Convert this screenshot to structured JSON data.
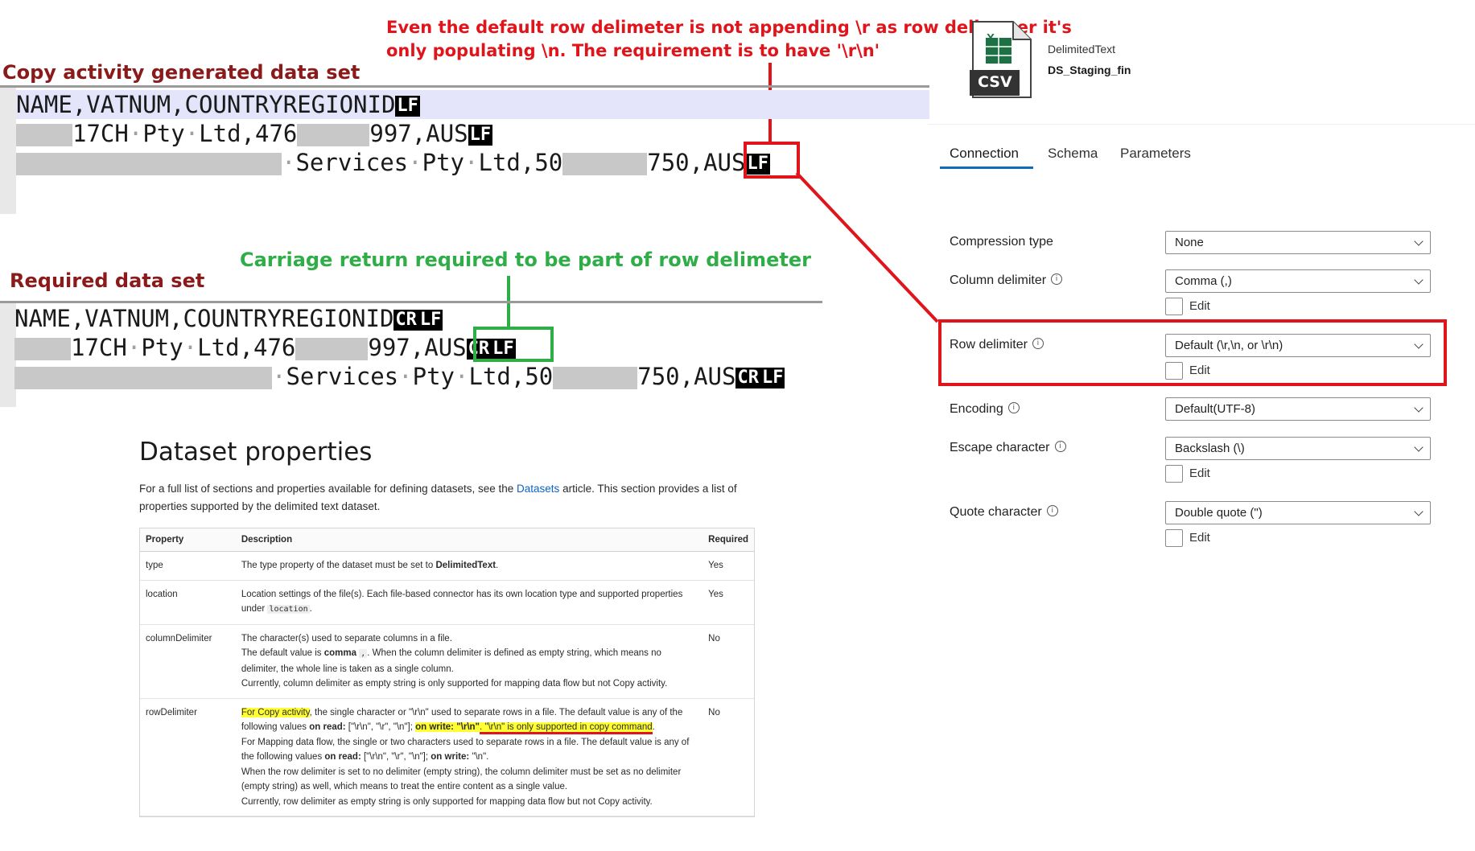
{
  "annotations": {
    "top_note_line1": "Even the default row delimeter is not appending \\r as row delimeter it's",
    "top_note_line2": "only populating \\n. The requirement is to have '\\r\\n'",
    "green_note": "Carriage return required to be part of row delimeter"
  },
  "copy_panel": {
    "label": "Copy activity generated data set",
    "line1_text": "NAME,VATNUM,COUNTRYREGIONID",
    "line1_eol": "LF",
    "line2_a": "17CH",
    "line2_b": "Pty",
    "line2_c": "Ltd,476",
    "line2_d": "997,AUS",
    "line2_eol": "LF",
    "line3_a": "Services",
    "line3_b": "Pty",
    "line3_c": "Ltd,50",
    "line3_d": "750,AUS",
    "line3_eol": "LF"
  },
  "required_panel": {
    "label": "Required data set",
    "line1_text": "NAME,VATNUM,COUNTRYREGIONID",
    "line1_eol_cr": "CR",
    "line1_eol_lf": "LF",
    "line2_a": "17CH",
    "line2_b": "Pty",
    "line2_c": "Ltd,476",
    "line2_d": "997,AUS",
    "line2_eol_cr": "CR",
    "line2_eol_lf": "LF",
    "line3_a": "Services",
    "line3_b": "Pty",
    "line3_c": "Ltd,50",
    "line3_d": "750,AUS",
    "line3_eol_cr": "CR",
    "line3_eol_lf": "LF"
  },
  "docs": {
    "title": "Dataset properties",
    "intro_a": "For a full list of sections and properties available for defining datasets, see the",
    "intro_link": "Datasets",
    "intro_b": "article. This section provides a list of properties supported by the delimited text dataset.",
    "headers": {
      "property": "Property",
      "description": "Description",
      "required": "Required"
    },
    "rows": {
      "type": {
        "property": "type",
        "desc_a": "The type property of the dataset must be set to",
        "desc_bold": "DelimitedText",
        "desc_b": ".",
        "required": "Yes"
      },
      "location": {
        "property": "location",
        "desc_a": "Location settings of the file(s). Each file-based connector has its own location type and supported properties under",
        "desc_code": "location",
        "desc_b": ".",
        "required": "Yes"
      },
      "columnDelimiter": {
        "property": "columnDelimiter",
        "p1": "The character(s) used to separate columns in a file.",
        "p2_a": "The default value is",
        "p2_bold": "comma",
        "p2_code": ",",
        "p2_b": ". When the column delimiter is defined as empty string, which means no delimiter, the whole line is taken as a single column.",
        "p3": "Currently, column delimiter as empty string is only supported for mapping data flow but not Copy activity.",
        "required": "No"
      },
      "rowDelimiter": {
        "property": "rowDelimiter",
        "p1_hl": "For Copy activity",
        "p1_a": ", the single character or \"\\r\\n\" used to separate rows in a file. The default value is any of the following values",
        "p1_bold1": "on read:",
        "p1_b": "[\"\\r\\n\", \"\\r\", \"\\n\"];",
        "p1_bold2": "on write: \"\\r\\n\"",
        "p1_hl2": ". \"\\r\\n\" is only supported in copy command",
        "p1_c": ".",
        "p2_a": "For Mapping data flow, the single or two characters used to separate rows in a file. The default value is any of the following values",
        "p2_bold1": "on read:",
        "p2_b": "[\"\\r\\n\", \"\\r\", \"\\n\"];",
        "p2_bold2": "on write:",
        "p2_c": "\"\\n\".",
        "p3": "When the row delimiter is set to no delimiter (empty string), the column delimiter must be set as no delimiter (empty string) as well, which means to treat the entire content as a single value.",
        "p4": "Currently, row delimiter as empty string is only supported for mapping data flow but not Copy activity.",
        "required": "No"
      }
    }
  },
  "dataset_panel": {
    "icon_label": "CSV",
    "icon_sheet": "X",
    "type": "DelimitedText",
    "name": "DS_Staging_fin",
    "tabs": [
      "Connection",
      "Schema",
      "Parameters"
    ],
    "active_tab": "Connection",
    "fields": {
      "compression": {
        "label": "Compression type",
        "value": "None"
      },
      "column_delimiter": {
        "label": "Column delimiter",
        "value": "Comma (,)",
        "edit": "Edit"
      },
      "row_delimiter": {
        "label": "Row delimiter",
        "value": "Default (\\r,\\n, or \\r\\n)",
        "edit": "Edit"
      },
      "encoding": {
        "label": "Encoding",
        "value": "Default(UTF-8)"
      },
      "escape": {
        "label": "Escape character",
        "value": "Backslash (\\)",
        "edit": "Edit"
      },
      "quote": {
        "label": "Quote character",
        "value": "Double quote (\")",
        "edit": "Edit"
      }
    }
  },
  "colors": {
    "red_annotation": "#e0151b",
    "green_annotation": "#2fad46",
    "label_dark_red": "#8b1a1a",
    "tab_accent": "#0f6cbd"
  }
}
